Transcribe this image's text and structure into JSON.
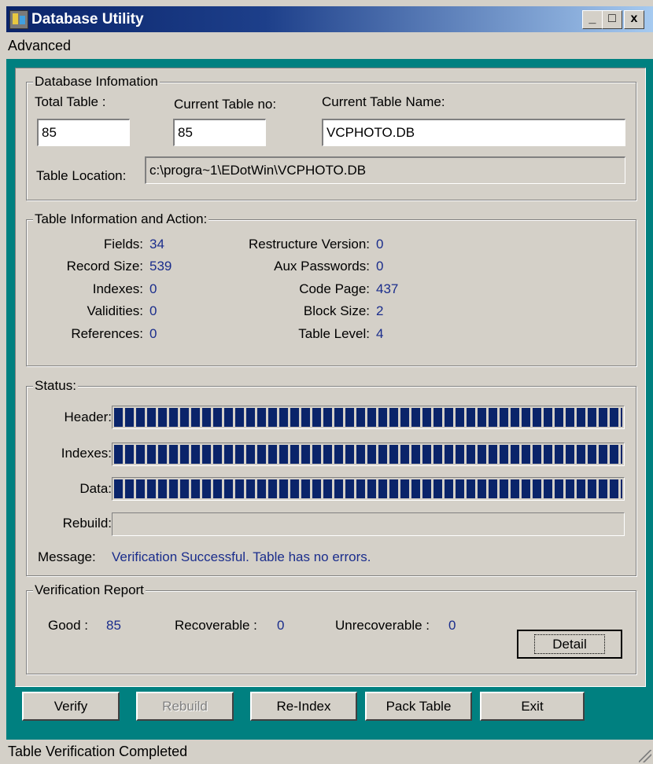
{
  "window": {
    "title": "Database Utility",
    "controls": {
      "minimize": "_",
      "maximize": "□",
      "close": "x"
    }
  },
  "menu": {
    "advanced": "Advanced"
  },
  "db_info": {
    "title": "Database Infomation",
    "total_table_label": "Total Table :",
    "total_table_value": "85",
    "current_table_no_label": "Current Table no:",
    "current_table_no_value": "85",
    "current_table_name_label": "Current Table Name:",
    "current_table_name_value": "VCPHOTO.DB",
    "table_location_label": "Table Location:",
    "table_location_value": "c:\\progra~1\\EDotWin\\VCPHOTO.DB"
  },
  "table_info": {
    "title": "Table Information and Action:",
    "left": [
      {
        "label": "Fields:",
        "value": "34"
      },
      {
        "label": "Record Size:",
        "value": "539"
      },
      {
        "label": "Indexes:",
        "value": "0"
      },
      {
        "label": "Validities:",
        "value": "0"
      },
      {
        "label": "References:",
        "value": "0"
      }
    ],
    "right": [
      {
        "label": "Restructure Version:",
        "value": "0"
      },
      {
        "label": "Aux Passwords:",
        "value": "0"
      },
      {
        "label": "Code Page:",
        "value": "437"
      },
      {
        "label": "Block Size:",
        "value": "2"
      },
      {
        "label": "Table Level:",
        "value": "4"
      }
    ]
  },
  "status": {
    "title": "Status:",
    "header_label": "Header:",
    "header_progress": 1.0,
    "indexes_label": "Indexes:",
    "indexes_progress": 1.0,
    "data_label": "Data:",
    "data_progress": 1.0,
    "rebuild_label": "Rebuild:",
    "rebuild_progress": 0.0,
    "message_label": "Message:",
    "message_value": "Verification Successful. Table has no errors."
  },
  "report": {
    "title": "Verification Report",
    "good_label": "Good :",
    "good_value": "85",
    "recoverable_label": "Recoverable :",
    "recoverable_value": "0",
    "unrecoverable_label": "Unrecoverable :",
    "unrecoverable_value": "0",
    "detail_button": "Detail"
  },
  "actions": {
    "verify": "Verify",
    "rebuild": "Rebuild",
    "reindex": "Re-Index",
    "pack_table": "Pack Table",
    "exit": "Exit"
  },
  "statusbar": {
    "text": "Table Verification Completed"
  },
  "colors": {
    "title_bar": "#0a246a",
    "value_text": "#1a2d8c",
    "background_teal": "#008080",
    "progress_fill": "#0a246a"
  }
}
